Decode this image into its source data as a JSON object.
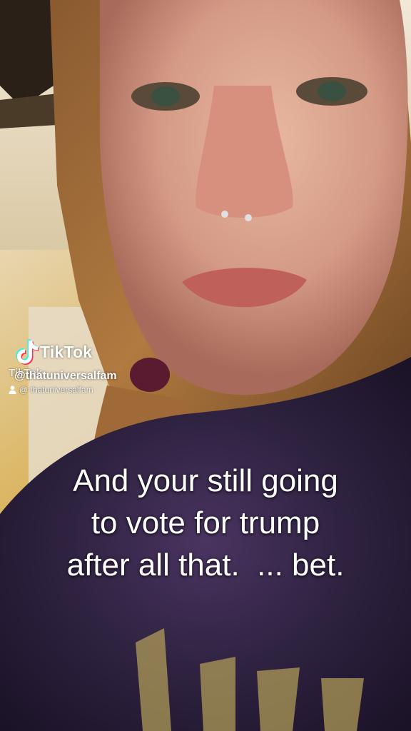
{
  "watermark": {
    "brand": "TikTok",
    "ghost_brand": "TikTok",
    "handle": "@thatuniversalfam",
    "sub_handle": "@ thatuniversalfam",
    "logo_icon": "tiktok-note-icon",
    "person_icon": "person-icon"
  },
  "caption": {
    "lines": [
      "And your still going",
      "to vote for trump",
      "after all that.  ... bet."
    ]
  },
  "colors": {
    "caption_text": "#ffffff",
    "tiktok_cyan": "#25f4ee",
    "tiktok_red": "#fe2c55",
    "wall_yellow": "#d9b25a"
  }
}
